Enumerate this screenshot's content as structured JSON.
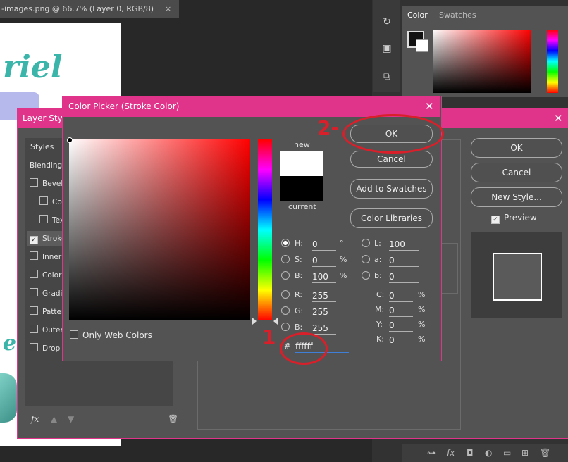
{
  "document": {
    "tab_title": "-images.png @ 66.7% (Layer 0, RGB/8)",
    "close_glyph": "×",
    "canvas_text": "riel",
    "canvas_text2": "e"
  },
  "color_panel": {
    "tabs": [
      "Color",
      "Swatches"
    ]
  },
  "layer_style": {
    "title": "Layer Style",
    "close_glyph": "✕",
    "styles_header": "Styles",
    "items": [
      {
        "label": "Blending O",
        "checkbox": false,
        "checked": false,
        "indent": false
      },
      {
        "label": "Bevel &",
        "checkbox": true,
        "checked": false,
        "indent": false
      },
      {
        "label": "Conto",
        "checkbox": true,
        "checked": false,
        "indent": true
      },
      {
        "label": "Textu",
        "checkbox": true,
        "checked": false,
        "indent": true
      },
      {
        "label": "Stroke",
        "checkbox": true,
        "checked": true,
        "indent": false
      },
      {
        "label": "Inner G",
        "checkbox": true,
        "checked": false,
        "indent": false
      },
      {
        "label": "Color O",
        "checkbox": true,
        "checked": false,
        "indent": false
      },
      {
        "label": "Gradien",
        "checkbox": true,
        "checked": false,
        "indent": false
      },
      {
        "label": "Pattern",
        "checkbox": true,
        "checked": false,
        "indent": false
      },
      {
        "label": "Outer G",
        "checkbox": true,
        "checked": false,
        "indent": false
      },
      {
        "label": "Drop S",
        "checkbox": true,
        "checked": false,
        "indent": false
      }
    ],
    "fx_label": "fx",
    "buttons": {
      "ok": "OK",
      "cancel": "Cancel",
      "new_style": "New Style..."
    },
    "preview_label": "Preview",
    "preview_checked": true
  },
  "color_picker": {
    "title": "Color Picker (Stroke Color)",
    "close_glyph": "✕",
    "new_label": "new",
    "current_label": "current",
    "buttons": {
      "ok": "OK",
      "cancel": "Cancel",
      "add_to_swatches": "Add to Swatches",
      "color_libraries": "Color Libraries"
    },
    "only_web_colors": "Only Web Colors",
    "hsb": {
      "h_label": "H:",
      "h": "0",
      "h_unit": "°",
      "s_label": "S:",
      "s": "0",
      "s_unit": "%",
      "b_label": "B:",
      "b": "100",
      "b_unit": "%"
    },
    "rgb": {
      "r_label": "R:",
      "r": "255",
      "g_label": "G:",
      "g": "255",
      "b_label": "B:",
      "b": "255"
    },
    "lab": {
      "l_label": "L:",
      "l": "100",
      "a_label": "a:",
      "a": "0",
      "b_label": "b:",
      "b": "0"
    },
    "cmyk": {
      "c_label": "C:",
      "c": "0",
      "m_label": "M:",
      "m": "0",
      "y_label": "Y:",
      "y": "0",
      "k_label": "K:",
      "k": "0",
      "unit": "%"
    },
    "hex_label": "#",
    "hex": "ffffff",
    "selected_color": "#ffffff",
    "current_color": "#000000"
  },
  "annotations": {
    "step1": "1",
    "step2": "2-",
    "color": "#d91f2a"
  }
}
